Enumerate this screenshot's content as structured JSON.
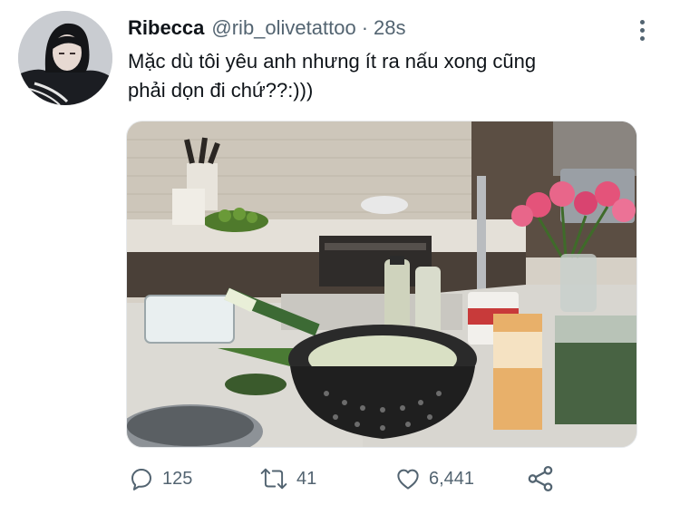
{
  "author": {
    "display_name": "Ribecca",
    "handle": "@rib_olivetattoo",
    "separator": "·",
    "time": "28s"
  },
  "tweet": {
    "text_line1": "Mặc dù tôi yêu anh nhưng ít ra nấu xong cũng",
    "text_line2": "phải dọn đi chứ??:)))"
  },
  "actions": {
    "replies": "125",
    "retweets": "41",
    "likes": "6,441"
  },
  "icons": {
    "more": "more-vertical-icon",
    "reply": "reply-icon",
    "retweet": "retweet-icon",
    "like": "heart-icon",
    "share": "share-icon"
  },
  "colors": {
    "text": "#0f1419",
    "secondary": "#536471"
  }
}
